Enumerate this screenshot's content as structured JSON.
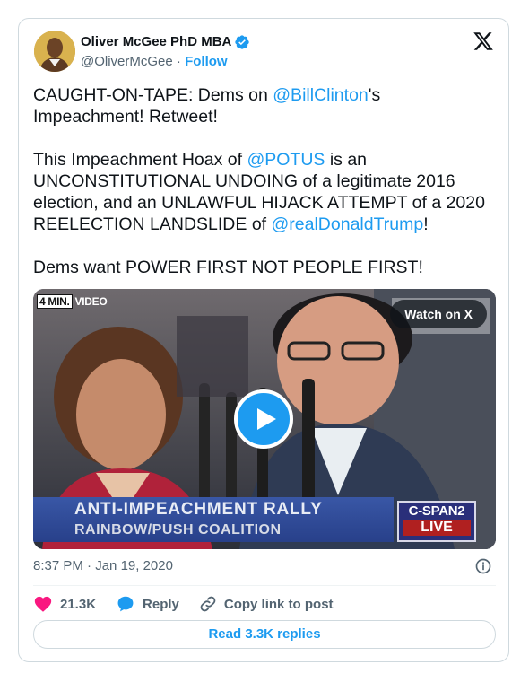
{
  "author": {
    "name": "Oliver McGee PhD MBA",
    "handle": "@OliverMcGee",
    "separator": "·",
    "follow_label": "Follow",
    "verified": true
  },
  "tweet": {
    "p1_a": "CAUGHT-ON-TAPE: Dems on ",
    "p1_mention": "@BillClinton",
    "p1_b": "'s Impeachment! Retweet!",
    "p2_a": "This Impeachment Hoax of ",
    "p2_mention1": "@POTUS",
    "p2_b": " is an UNCONSTITUTIONAL UNDOING of a legitimate 2016 election, and an UNLAWFUL HIJACK ATTEMPT of a 2020 REELECTION LANDSLIDE of ",
    "p2_mention2": "@realDonaldTrump",
    "p2_c": "!",
    "p3": "Dems want POWER FIRST NOT PEOPLE FIRST!"
  },
  "media": {
    "duration_box": "4 MIN.",
    "video_label": "VIDEO",
    "watch_label": "Watch on X",
    "lower_third_line1": "ANTI-IMPEACHMENT  RALLY",
    "lower_third_line2": "RAINBOW/PUSH  COALITION",
    "network": "C-SPAN2",
    "live": "LIVE"
  },
  "meta": {
    "time": "8:37 PM",
    "separator": "·",
    "date": "Jan 19, 2020"
  },
  "actions": {
    "likes": "21.3K",
    "reply_label": "Reply",
    "copy_label": "Copy link to post"
  },
  "footer": {
    "read_replies": "Read 3.3K replies"
  },
  "colors": {
    "accent": "#1d9bf0",
    "like": "#f91880",
    "muted": "#536471",
    "border": "#cfd9de"
  }
}
